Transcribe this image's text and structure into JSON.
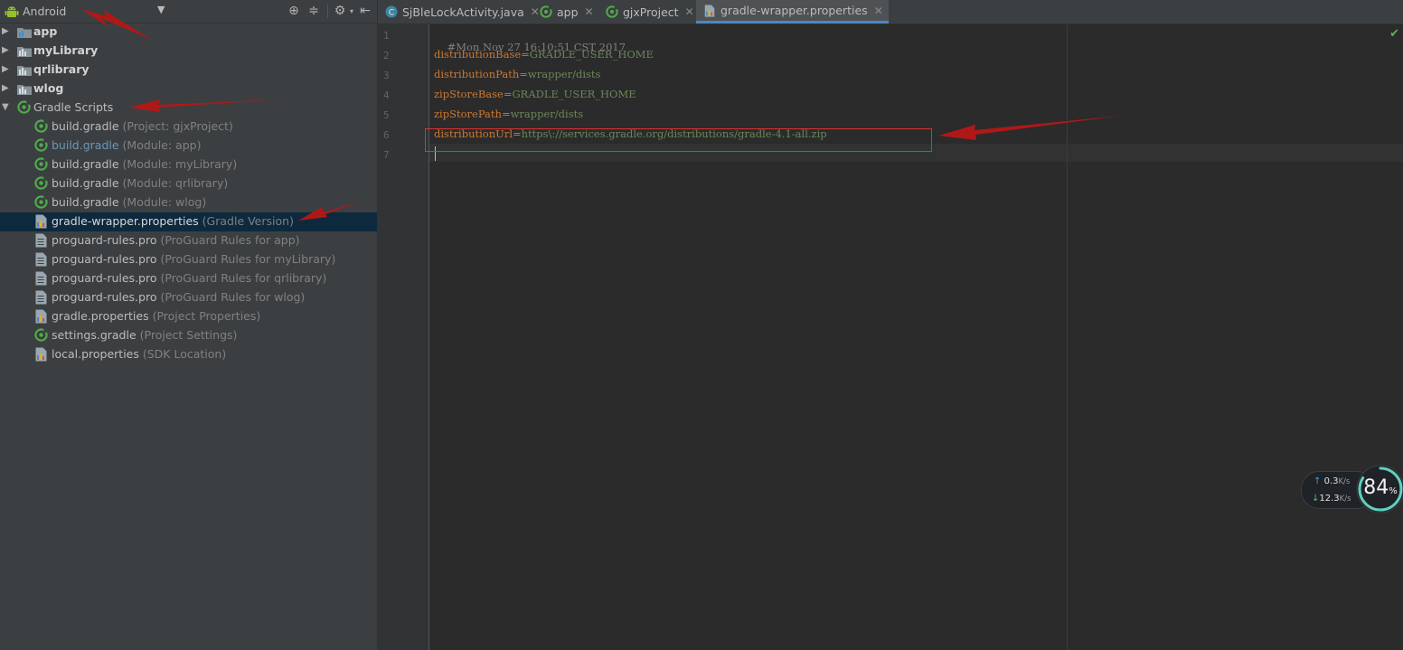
{
  "project_panel": {
    "view_select": {
      "label": "Android"
    },
    "tree": [
      {
        "label": "app",
        "note": "",
        "kind": "module",
        "expanded": false
      },
      {
        "label": "myLibrary",
        "note": "",
        "kind": "module",
        "expanded": false
      },
      {
        "label": "qrlibrary",
        "note": "",
        "kind": "module",
        "expanded": false
      },
      {
        "label": "wlog",
        "note": "",
        "kind": "module",
        "expanded": false
      },
      {
        "label": "Gradle Scripts",
        "note": "",
        "kind": "gradle-group",
        "expanded": true
      },
      {
        "label": "build.gradle",
        "note": "(Project: gjxProject)",
        "kind": "gradle-file"
      },
      {
        "label": "build.gradle",
        "note": "(Module: app)",
        "kind": "gradle-file"
      },
      {
        "label": "build.gradle",
        "note": "(Module: myLibrary)",
        "kind": "gradle-file"
      },
      {
        "label": "build.gradle",
        "note": "(Module: qrlibrary)",
        "kind": "gradle-file"
      },
      {
        "label": "build.gradle",
        "note": "(Module: wlog)",
        "kind": "gradle-file"
      },
      {
        "label": "gradle-wrapper.properties",
        "note": "(Gradle Version)",
        "kind": "properties-file",
        "selected": true
      },
      {
        "label": "proguard-rules.pro",
        "note": "(ProGuard Rules for app)",
        "kind": "text-file"
      },
      {
        "label": "proguard-rules.pro",
        "note": "(ProGuard Rules for myLibrary)",
        "kind": "text-file"
      },
      {
        "label": "proguard-rules.pro",
        "note": "(ProGuard Rules for qrlibrary)",
        "kind": "text-file"
      },
      {
        "label": "proguard-rules.pro",
        "note": "(ProGuard Rules for wlog)",
        "kind": "text-file"
      },
      {
        "label": "gradle.properties",
        "note": "(Project Properties)",
        "kind": "properties-file"
      },
      {
        "label": "settings.gradle",
        "note": "(Project Settings)",
        "kind": "gradle-file"
      },
      {
        "label": "local.properties",
        "note": "(SDK Location)",
        "kind": "properties-file"
      }
    ]
  },
  "tabs": [
    {
      "label": "SjBleLockActivity.java",
      "icon": "java-class-icon"
    },
    {
      "label": "app",
      "icon": "gradle-icon"
    },
    {
      "label": "gjxProject",
      "icon": "gradle-icon"
    },
    {
      "label": "gradle-wrapper.properties",
      "icon": "properties-icon",
      "active": true
    }
  ],
  "editor": {
    "line_numbers": [
      "1",
      "2",
      "3",
      "4",
      "5",
      "6",
      "7"
    ],
    "lines": [
      {
        "comment": "#Mon Nov 27 16:10:51 CST 2017"
      },
      {
        "key": "distributionBase",
        "eq": "=",
        "value": "GRADLE_USER_HOME"
      },
      {
        "key": "distributionPath",
        "eq": "=",
        "value": "wrapper/dists"
      },
      {
        "key": "zipStoreBase",
        "eq": "=",
        "value": "GRADLE_USER_HOME"
      },
      {
        "key": "zipStorePath",
        "eq": "=",
        "value": "wrapper/dists"
      },
      {
        "key": "distributionUrl",
        "eq": "=",
        "value": "https\\://services.gradle.org/distributions/gradle-4.1-all.zip"
      },
      {
        "comment": ""
      }
    ]
  },
  "network_monitor": {
    "upload": "0.3",
    "upload_unit": "K/s",
    "download": "12.3",
    "download_unit": "K/s",
    "percent": "84",
    "percent_sign": "%"
  },
  "colors": {
    "selection": "#0d293e",
    "accent": "#4a88c7",
    "annotation": "#b01818",
    "highlight_box": "#e03030"
  }
}
